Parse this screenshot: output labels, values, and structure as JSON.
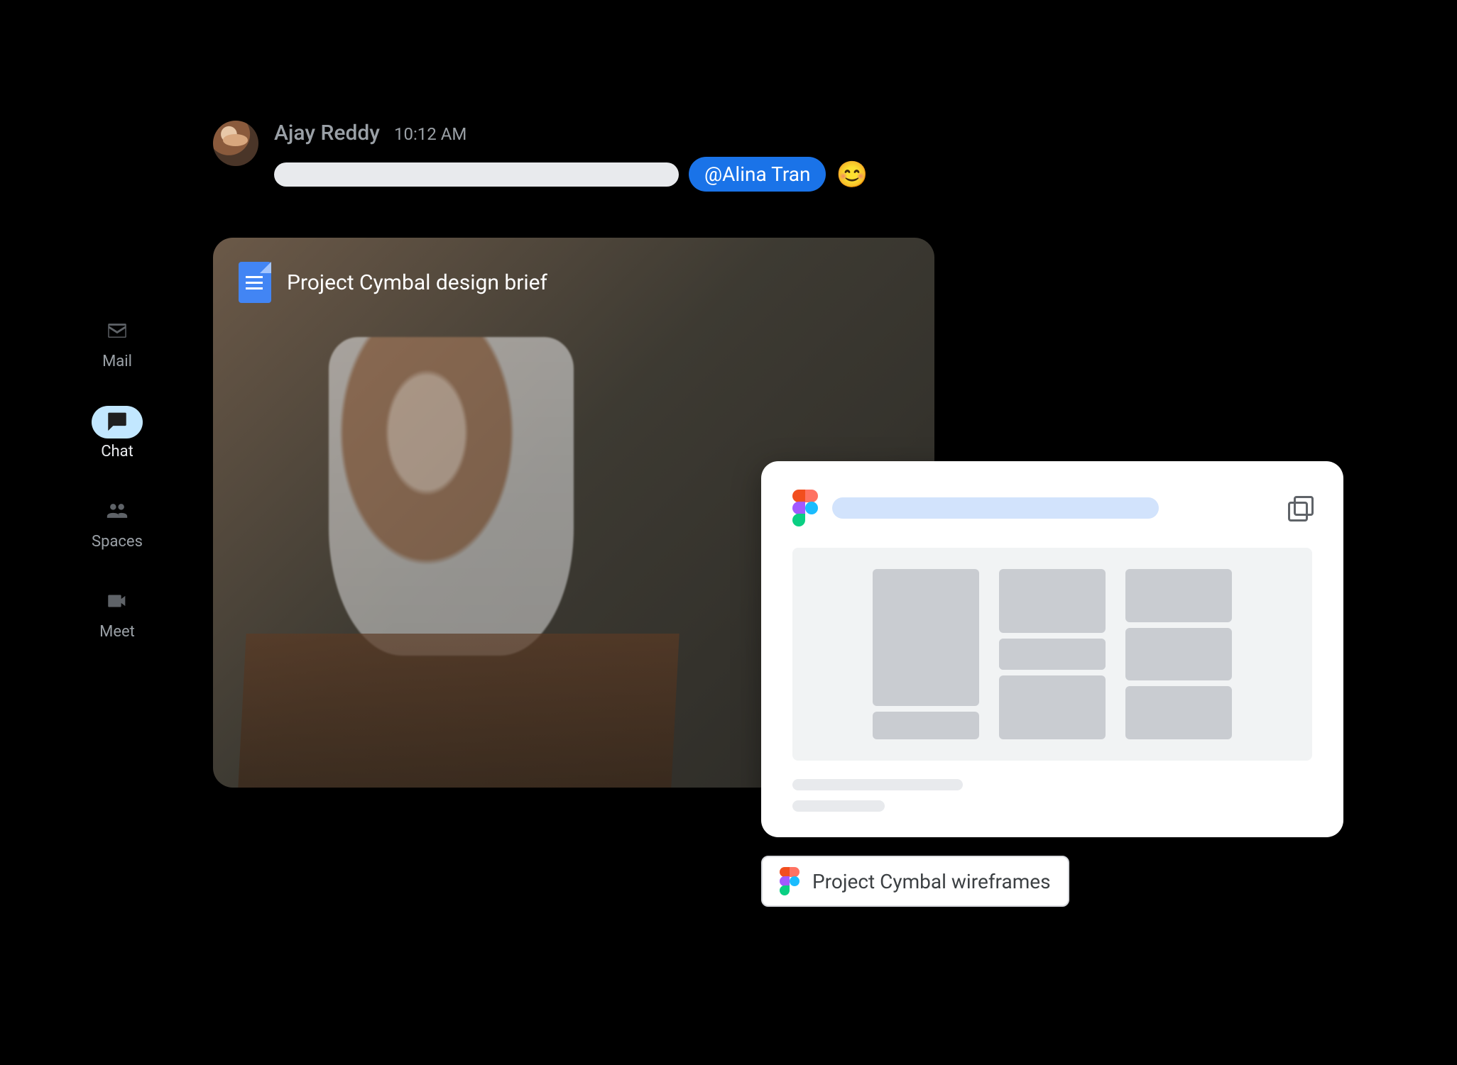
{
  "sidebar": {
    "items": [
      {
        "label": "Mail"
      },
      {
        "label": "Chat"
      },
      {
        "label": "Spaces"
      },
      {
        "label": "Meet"
      }
    ],
    "active_index": 1
  },
  "message": {
    "sender": "Ajay Reddy",
    "time": "10:12 AM",
    "mention": "Alina Tran",
    "emoji": "😊"
  },
  "doc": {
    "title": "Project Cymbal design brief"
  },
  "figma_chip": {
    "label": "Project Cymbal wireframes"
  }
}
